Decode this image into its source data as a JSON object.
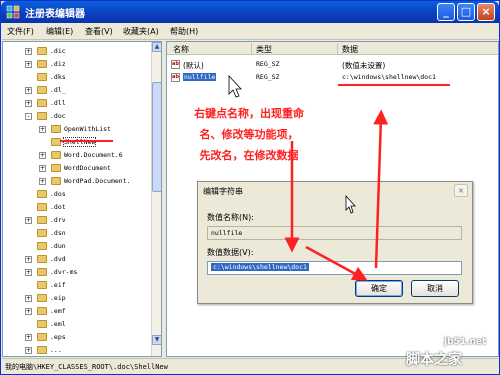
{
  "window": {
    "title": "注册表编辑器",
    "minimize": "_",
    "maximize": "□",
    "close": "×"
  },
  "menu": [
    "文件(F)",
    "编辑(E)",
    "查看(V)",
    "收藏夹(A)",
    "帮助(H)"
  ],
  "tree": {
    "items": [
      {
        "label": ".dic",
        "expander": "+"
      },
      {
        "label": ".diz",
        "expander": "+"
      },
      {
        "label": ".dks",
        "expander": ""
      },
      {
        "label": ".dl_",
        "expander": "+"
      },
      {
        "label": ".dll",
        "expander": "+"
      },
      {
        "label": ".doc",
        "expander": "-"
      },
      {
        "label": "OpenWithList",
        "expander": "+"
      },
      {
        "label": "ShellNew",
        "expander": ""
      },
      {
        "label": "Word.Document.6",
        "expander": "+"
      },
      {
        "label": "WordDocument",
        "expander": "+"
      },
      {
        "label": "WordPad.Document.",
        "expander": "+"
      },
      {
        "label": ".dos",
        "expander": ""
      },
      {
        "label": ".dot",
        "expander": ""
      },
      {
        "label": ".drv",
        "expander": "+"
      },
      {
        "label": ".dsn",
        "expander": ""
      },
      {
        "label": ".dun",
        "expander": ""
      },
      {
        "label": ".dvd",
        "expander": "+"
      },
      {
        "label": ".dvr-ms",
        "expander": "+"
      },
      {
        "label": ".eif",
        "expander": ""
      },
      {
        "label": ".eip",
        "expander": "+"
      },
      {
        "label": ".emf",
        "expander": "+"
      },
      {
        "label": ".eml",
        "expander": ""
      },
      {
        "label": ".eps",
        "expander": "+"
      },
      {
        "label": "...",
        "expander": "+"
      }
    ],
    "scroll_up": "▲",
    "scroll_down": "▼"
  },
  "list": {
    "headers": [
      "名称",
      "类型",
      "数据"
    ],
    "rows": [
      {
        "icon": "ab",
        "name": "(默认)",
        "type": "REG_SZ",
        "data": "(数值未设置)"
      },
      {
        "icon": "ab",
        "name": "nullfile",
        "type": "REG_SZ",
        "data": "c:\\windows\\shellnew\\doc1"
      }
    ]
  },
  "status": "我的电脑\\HKEY_CLASSES_ROOT\\.doc\\ShellNew",
  "annotation": [
    "右键点名称，出现重命",
    "名、修改等功能项，",
    "先改名，在修改数据"
  ],
  "dialog": {
    "title": "编辑字符串",
    "close": "×",
    "name_label": "数值名称(N):",
    "name_value": "nullfile",
    "data_label": "数值数据(V):",
    "data_value": "c:\\windows\\shellnew\\doc1",
    "ok": "确定",
    "cancel": "取消"
  },
  "watermark": {
    "site": "jb51.net",
    "name": "脚本之家"
  },
  "colors": {
    "annotation_red": "#ff2020",
    "selection_blue": "#316ac5"
  }
}
